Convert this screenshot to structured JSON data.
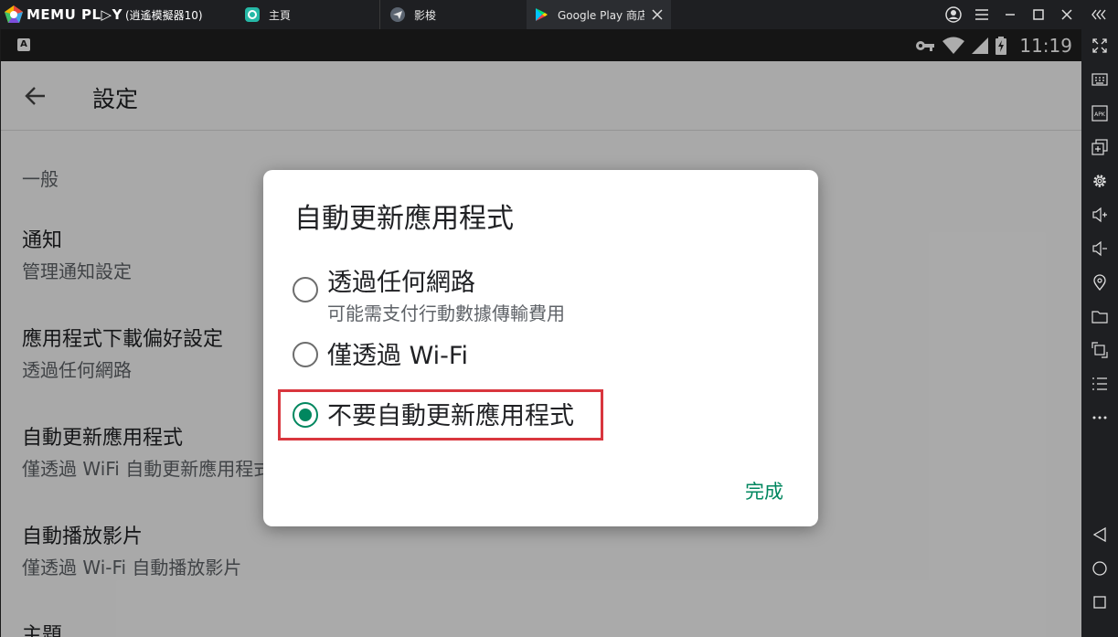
{
  "titlebar": {
    "app_name": "MEMU PL▷Y",
    "instance": "(逍遙模擬器10)",
    "tabs": [
      {
        "label": "主頁"
      },
      {
        "label": "影梭"
      },
      {
        "label": "Google Play 商店"
      }
    ]
  },
  "statusbar": {
    "keyboard_indicator": "A",
    "time": "11:19"
  },
  "appbar": {
    "title": "設定"
  },
  "settings": {
    "section_header": "一般",
    "items": [
      {
        "title": "通知",
        "subtitle": "管理通知設定"
      },
      {
        "title": "應用程式下載偏好設定",
        "subtitle": "透過任何網路"
      },
      {
        "title": "自動更新應用程式",
        "subtitle": "僅透過 WiFi 自動更新應用程式"
      },
      {
        "title": "自動播放影片",
        "subtitle": "僅透過 Wi-Fi 自動播放影片"
      },
      {
        "title": "主題",
        "subtitle": ""
      }
    ]
  },
  "dialog": {
    "title": "自動更新應用程式",
    "options": [
      {
        "label": "透過任何網路",
        "sublabel": "可能需支付行動數據傳輸費用",
        "selected": false
      },
      {
        "label": "僅透過 Wi-Fi",
        "sublabel": "",
        "selected": false
      },
      {
        "label": "不要自動更新應用程式",
        "sublabel": "",
        "selected": true
      }
    ],
    "done_label": "完成"
  },
  "colors": {
    "accent": "#01875f",
    "highlight": "#d9363e",
    "chrome": "#1e1f22"
  }
}
